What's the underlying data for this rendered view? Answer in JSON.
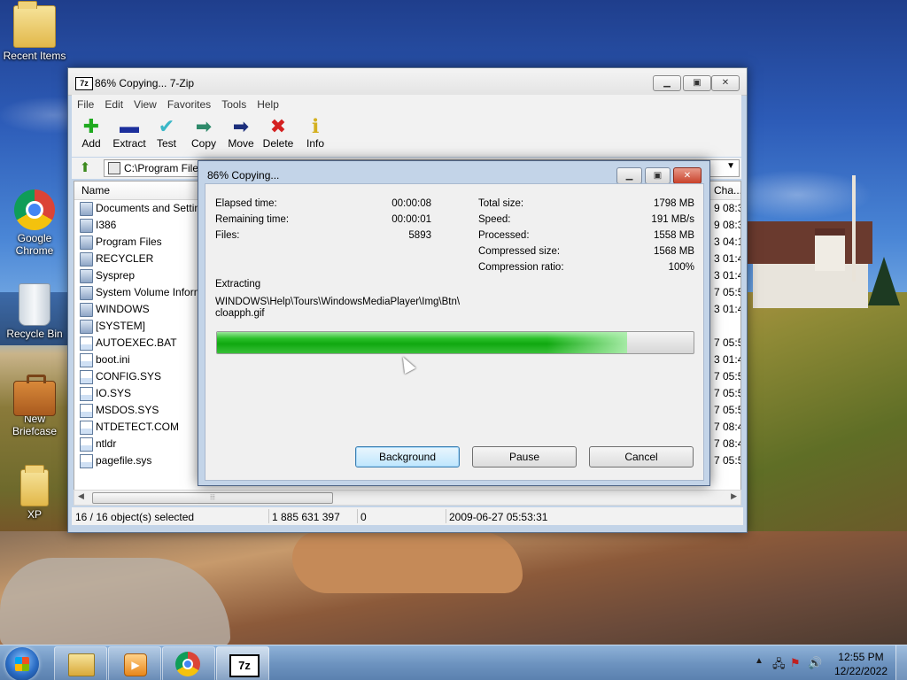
{
  "desktop": {
    "icons": [
      {
        "label": "Recent Items"
      },
      {
        "label": "Google Chrome"
      },
      {
        "label": "Recycle Bin"
      },
      {
        "label": "New Briefcase"
      },
      {
        "label": "XP"
      }
    ]
  },
  "main_window": {
    "title": "86% Copying... 7-Zip",
    "app_icon_label": "7z",
    "menu": [
      "File",
      "Edit",
      "View",
      "Favorites",
      "Tools",
      "Help"
    ],
    "toolbar": [
      {
        "label": "Add",
        "icon": "plus-icon",
        "color": "#1faa1f"
      },
      {
        "label": "Extract",
        "icon": "minus-icon",
        "color": "#1c2f9c"
      },
      {
        "label": "Test",
        "icon": "check-icon",
        "color": "#3ab7c7"
      },
      {
        "label": "Copy",
        "icon": "copy-arrow-icon",
        "color": "#2e8a6a"
      },
      {
        "label": "Move",
        "icon": "move-arrow-icon",
        "color": "#1c2f7c"
      },
      {
        "label": "Delete",
        "icon": "x-icon",
        "color": "#d42020"
      },
      {
        "label": "Info",
        "icon": "info-icon",
        "color": "#d4b020"
      }
    ],
    "address": "C:\\Program Files",
    "columns": {
      "name": "Name",
      "changed": "Cha..."
    },
    "files": [
      {
        "name": "Documents and Settings",
        "type": "folder",
        "date": "9 08:3"
      },
      {
        "name": "I386",
        "type": "folder",
        "date": "9 08:3"
      },
      {
        "name": "Program Files",
        "type": "folder",
        "date": "3 04:1"
      },
      {
        "name": "RECYCLER",
        "type": "folder",
        "date": "3 01:4"
      },
      {
        "name": "Sysprep",
        "type": "folder",
        "date": "3 01:4"
      },
      {
        "name": "System Volume Information",
        "type": "folder",
        "date": "7 05:5"
      },
      {
        "name": "WINDOWS",
        "type": "folder",
        "date": "3 01:4"
      },
      {
        "name": "[SYSTEM]",
        "type": "folder",
        "date": ""
      },
      {
        "name": "AUTOEXEC.BAT",
        "type": "file",
        "date": "7 05:5"
      },
      {
        "name": "boot.ini",
        "type": "file",
        "date": "3 01:4"
      },
      {
        "name": "CONFIG.SYS",
        "type": "file",
        "date": "7 05:5"
      },
      {
        "name": "IO.SYS",
        "type": "file",
        "date": "7 05:5"
      },
      {
        "name": "MSDOS.SYS",
        "type": "file",
        "date": "7 05:5"
      },
      {
        "name": "NTDETECT.COM",
        "type": "file",
        "date": "7 08:4"
      },
      {
        "name": "ntldr",
        "type": "file",
        "date": "7 08:4"
      },
      {
        "name": "pagefile.sys",
        "type": "file",
        "date": "7 05:5"
      }
    ],
    "status": {
      "selected": "16 / 16 object(s) selected",
      "size": "1 885 631 397",
      "packed": "0",
      "modified": "2009-06-27 05:53:31"
    }
  },
  "dialog": {
    "title": "86% Copying...",
    "left_stats": [
      {
        "label": "Elapsed time:",
        "value": "00:00:08"
      },
      {
        "label": "Remaining time:",
        "value": "00:00:01"
      },
      {
        "label": "Files:",
        "value": "5893"
      }
    ],
    "right_stats": [
      {
        "label": "Total size:",
        "value": "1798 MB"
      },
      {
        "label": "Speed:",
        "value": "191 MB/s"
      },
      {
        "label": "Processed:",
        "value": "1558 MB"
      },
      {
        "label": "Compressed size:",
        "value": "1568 MB"
      },
      {
        "label": "Compression ratio:",
        "value": "100%"
      }
    ],
    "operation": "Extracting",
    "current_file_line1": "WINDOWS\\Help\\Tours\\WindowsMediaPlayer\\Img\\Btn\\",
    "current_file_line2": "cloapph.gif",
    "progress_fraction": 0.86,
    "buttons": {
      "background": "Background",
      "pause": "Pause",
      "cancel": "Cancel"
    }
  },
  "taskbar": {
    "apps": [
      {
        "name": "explorer",
        "icon": "folder-icon"
      },
      {
        "name": "media-player",
        "icon": "media-player-icon"
      },
      {
        "name": "chrome",
        "icon": "chrome-icon"
      },
      {
        "name": "7zip",
        "icon": "7zip-icon",
        "label": "7z"
      }
    ],
    "time": "12:55 PM",
    "date": "12/22/2022"
  }
}
